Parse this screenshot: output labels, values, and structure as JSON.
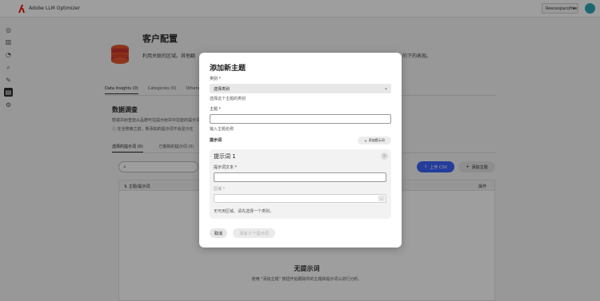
{
  "app": {
    "title": "Adobe LLM Optimizer",
    "org": "Reecespacoffee",
    "brand_color": "#eb1000"
  },
  "page": {
    "title": "客户配置",
    "subtitle": "利用关联的区域。其他翻",
    "subtitle_right": "的下的表现。",
    "tabs": [
      {
        "label": "Data Insights (0)",
        "active": true
      },
      {
        "label": "Categories (0)",
        "active": false
      },
      {
        "label": "Others Tra",
        "active": false
      }
    ],
    "section_title": "数据调查",
    "section_desc": "帮或并射查担从品牌可在提示射并中拉能的提示词。",
    "section_note": "在全搜索之前，新添加的提示词不会显示在",
    "subtabs": [
      {
        "label": "选择的提示词 (0)",
        "active": true
      },
      {
        "label": "已删除的提示词 (0)",
        "active": false
      }
    ],
    "upload_csv_label": "上传 CSV",
    "add_topic_label": "添加主题",
    "table": {
      "col_topic": "主题/提示词",
      "col_actions": "操作"
    },
    "empty_title": "无提示词",
    "empty_desc": "使用 \"添加主题\" 按钮开始跟踪所的主题和提示词以进行分析。",
    "accent_color": "#3b63fb"
  },
  "modal": {
    "title": "添加新主题",
    "category_label": "类别 *",
    "category_value": "选择类别",
    "category_help": "选择这个主题的类别",
    "topic_label": "主题 *",
    "topic_value": "",
    "topic_help": "输入主题名称",
    "prompts_label": "提示词",
    "add_prompt_label": "添加提示词",
    "prompt_card": {
      "title": "提示词 1",
      "text_label": "提示词文本 *",
      "text_value": "",
      "region_label": "区域 *",
      "region_help": "无可用区域。请先选择一个类别。"
    },
    "cancel_label": "取消",
    "submit_label": "添加 0 个提示词"
  },
  "icons": {
    "nav": [
      "dashboard-icon",
      "chart-icon",
      "gauge-icon",
      "search-icon",
      "tools-icon",
      "customer-config-icon",
      "settings-icon"
    ]
  }
}
